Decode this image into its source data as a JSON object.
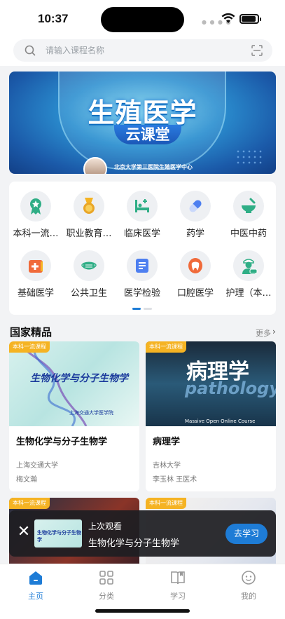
{
  "status_bar": {
    "time": "10:37"
  },
  "search": {
    "placeholder": "请输入课程名称"
  },
  "banner": {
    "title": "生殖医学",
    "subtitle": "云课堂",
    "caption": "北京大学第三医院生殖医学中心"
  },
  "categories": [
    {
      "label": "本科一流…",
      "icon": "award-ribbon-icon",
      "color": "#2fae86"
    },
    {
      "label": "职业教育…",
      "icon": "medal-icon",
      "color": "#e9a628"
    },
    {
      "label": "临床医学",
      "icon": "hospital-bed-icon",
      "color": "#2fae86"
    },
    {
      "label": "药学",
      "icon": "capsule-icon",
      "color": "#4d7ff0"
    },
    {
      "label": "中医中药",
      "icon": "mortar-icon",
      "color": "#2fae86"
    },
    {
      "label": "基础医学",
      "icon": "medical-kit-icon",
      "color": "#f06a3a"
    },
    {
      "label": "公共卫生",
      "icon": "face-mask-icon",
      "color": "#2fae86"
    },
    {
      "label": "医学检验",
      "icon": "checklist-icon",
      "color": "#4d7ff0"
    },
    {
      "label": "口腔医学",
      "icon": "tooth-icon",
      "color": "#f06a3a"
    },
    {
      "label": "护理（本…",
      "icon": "nurse-icon",
      "color": "#2fae86"
    }
  ],
  "section": {
    "title": "国家精品",
    "more": "更多"
  },
  "courses": [
    {
      "badge": "本科一流课程",
      "name": "生物化学与分子生物学",
      "school": "上海交通大学",
      "teacher": "梅文瀚",
      "thumb_text": "生物化学与分子生物学",
      "thumb_school": "上海交通大学医学院"
    },
    {
      "badge": "本科一流课程",
      "name": "病理学",
      "school": "吉林大学",
      "teacher": "李玉林 王医术",
      "thumb_text": "病理学",
      "thumb_en": "pathology",
      "thumb_mooc": "Massive Open Online Course"
    },
    {
      "badge": "本科一流课程"
    },
    {
      "badge": "本科一流课程"
    }
  ],
  "resume": {
    "label": "上次观看",
    "title": "生物化学与分子生物学",
    "thumb_text": "生物化学与分子生物学",
    "button": "去学习"
  },
  "tabs": [
    {
      "label": "主页",
      "icon": "home-icon",
      "active": true
    },
    {
      "label": "分类",
      "icon": "grid-icon",
      "active": false
    },
    {
      "label": "学习",
      "icon": "book-icon",
      "active": false
    },
    {
      "label": "我的",
      "icon": "profile-icon",
      "active": false
    }
  ],
  "colors": {
    "accent": "#1e7cd6",
    "badge": "#f5b323",
    "background": "#f2f3f5"
  }
}
